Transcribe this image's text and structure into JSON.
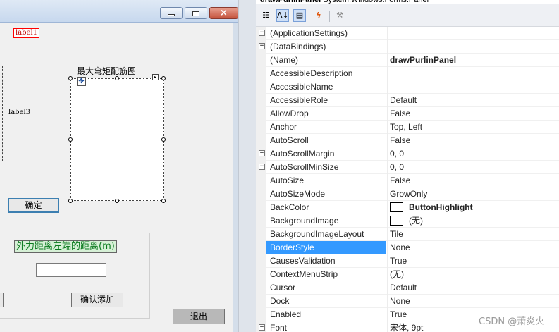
{
  "designer": {
    "label1": "label1",
    "label3": "label3",
    "panel_title": "最大弯矩配筋图",
    "confirm_button": "确定",
    "distance_label": "外力距离左端的距离(m)",
    "distance_input": "",
    "add_button": "确认添加",
    "exit_button": "退出",
    "move_glyph": "✥",
    "smart_tag_glyph": "▸"
  },
  "properties": {
    "header": "drawPurlinPanel System.Windows.Forms.Panel",
    "header_name": "drawPurlinPanel",
    "header_type": "System.Windows.Forms.Panel",
    "toolbar": {
      "categorized_icon": "categorized-icon",
      "alphabetical_icon": "alphabetical-icon",
      "properties_icon": "properties-icon",
      "events_icon": "events-icon",
      "property_pages_icon": "wrench-icon"
    },
    "rows": [
      {
        "name": "(ApplicationSettings)",
        "value": "",
        "expandable": true
      },
      {
        "name": "(DataBindings)",
        "value": "",
        "expandable": true
      },
      {
        "name": "(Name)",
        "value": "drawPurlinPanel",
        "bold": true
      },
      {
        "name": "AccessibleDescription",
        "value": ""
      },
      {
        "name": "AccessibleName",
        "value": ""
      },
      {
        "name": "AccessibleRole",
        "value": "Default"
      },
      {
        "name": "AllowDrop",
        "value": "False"
      },
      {
        "name": "Anchor",
        "value": "Top, Left"
      },
      {
        "name": "AutoScroll",
        "value": "False"
      },
      {
        "name": "AutoScrollMargin",
        "value": "0, 0",
        "expandable": true
      },
      {
        "name": "AutoScrollMinSize",
        "value": "0, 0",
        "expandable": true
      },
      {
        "name": "AutoSize",
        "value": "False"
      },
      {
        "name": "AutoSizeMode",
        "value": "GrowOnly"
      },
      {
        "name": "BackColor",
        "value": "ButtonHighlight",
        "bold": true,
        "swatch": "#ffffff"
      },
      {
        "name": "BackgroundImage",
        "value": "(无)",
        "swatch": "#ffffff"
      },
      {
        "name": "BackgroundImageLayout",
        "value": "Tile"
      },
      {
        "name": "BorderStyle",
        "value": "None",
        "selected": true
      },
      {
        "name": "CausesValidation",
        "value": "True"
      },
      {
        "name": "ContextMenuStrip",
        "value": "(无)"
      },
      {
        "name": "Cursor",
        "value": "Default"
      },
      {
        "name": "Dock",
        "value": "None"
      },
      {
        "name": "Enabled",
        "value": "True"
      },
      {
        "name": "Font",
        "value": "宋体, 9pt",
        "expandable": true
      }
    ]
  },
  "watermark": "CSDN @萧炎火",
  "colors": {
    "selection": "#3399ff",
    "label1_border": "#ff0000",
    "distance_label_bg": "#d6f0d6",
    "distance_label_text": "#0b7a1f",
    "confirm_border": "#3c7fb1",
    "events_icon": "#e0560c"
  }
}
